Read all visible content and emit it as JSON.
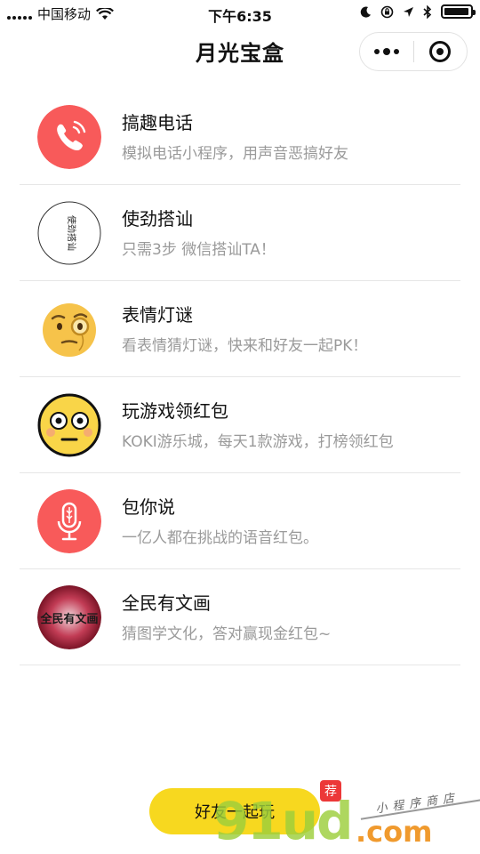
{
  "status_bar": {
    "carrier": "中国移动",
    "time": "下午6:35",
    "battery_level": 0.95
  },
  "nav": {
    "title": "月光宝盒"
  },
  "apps": [
    {
      "name": "搞趣电话",
      "description": "模拟电话小程序，用声音恶搞好友",
      "icon": "phone-icon"
    },
    {
      "name": "使劲搭讪",
      "description": "只需3步 微信搭讪TA！",
      "icon": "calligraphy-icon",
      "icon_text": "使劲搭讪"
    },
    {
      "name": "表情灯谜",
      "description": "看表情猜灯谜，快来和好友一起PK！",
      "icon": "monocle-face-icon"
    },
    {
      "name": "玩游戏领红包",
      "description": "KOKI游乐城，每天1款游戏，打榜领红包",
      "icon": "dizzy-face-icon"
    },
    {
      "name": "包你说",
      "description": "一亿人都在挑战的语音红包。",
      "icon": "microphone-icon"
    },
    {
      "name": "全民有文画",
      "description": "猜图学文化，答对赢现金红包~",
      "icon": "painting-logo-icon",
      "icon_text": "全民有文画"
    }
  ],
  "bottom": {
    "play_label": "好友一起玩",
    "badge": "荐"
  },
  "watermark": {
    "main": "91ud",
    "domain": ".com",
    "tagline": "小程序商店"
  },
  "colors": {
    "accent_red": "#f85a5a",
    "button_yellow": "#f7d81f",
    "badge_red": "#ec3838",
    "watermark_green": "#9cce3c",
    "watermark_orange": "#f09a2e"
  }
}
